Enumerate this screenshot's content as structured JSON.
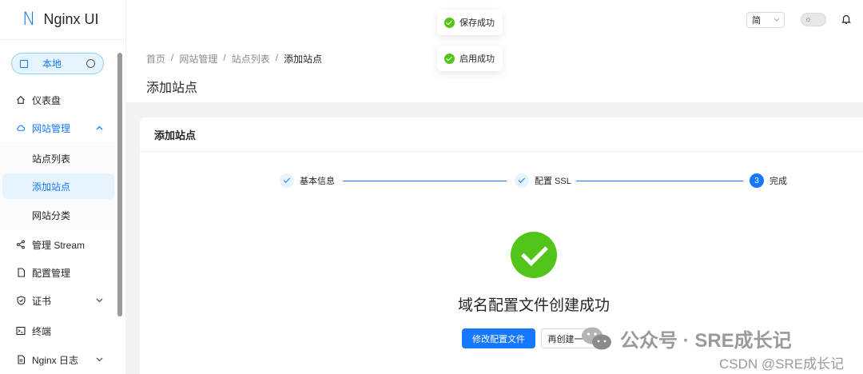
{
  "app": {
    "logo_letter": "N",
    "title": "Nginx UI"
  },
  "environment": {
    "label": "本地"
  },
  "sidebar": {
    "items": [
      {
        "label": "仪表盘",
        "icon": "home-icon"
      },
      {
        "label": "网站管理",
        "icon": "cloud-icon",
        "expanded": true
      },
      {
        "label": "管理 Stream",
        "icon": "share-icon"
      },
      {
        "label": "配置管理",
        "icon": "file-icon"
      },
      {
        "label": "证书",
        "icon": "shield-check-icon"
      },
      {
        "label": "终端",
        "icon": "terminal-icon"
      },
      {
        "label": "Nginx 日志",
        "icon": "log-icon"
      }
    ],
    "subitems": [
      {
        "label": "站点列表"
      },
      {
        "label": "添加站点",
        "active": true
      },
      {
        "label": "网站分类"
      }
    ]
  },
  "header": {
    "language": "简"
  },
  "toasts": [
    {
      "text": "保存成功"
    },
    {
      "text": "启用成功"
    }
  ],
  "breadcrumb": [
    "首页",
    "网站管理",
    "站点列表",
    "添加站点"
  ],
  "page_title": "添加站点",
  "card": {
    "title": "添加站点"
  },
  "steps": [
    {
      "label": "基本信息",
      "status": "done"
    },
    {
      "label": "配置 SSL",
      "status": "done"
    },
    {
      "label": "完成",
      "status": "current",
      "number": "3"
    }
  ],
  "result": {
    "title": "域名配置文件创建成功",
    "primary_button": "修改配置文件",
    "secondary_button": "再创建一个"
  },
  "watermarks": {
    "wechat": "公众号 · SRE成长记",
    "csdn": "CSDN @SRE成长记"
  },
  "colors": {
    "primary": "#1677ff",
    "success": "#52c41a"
  }
}
